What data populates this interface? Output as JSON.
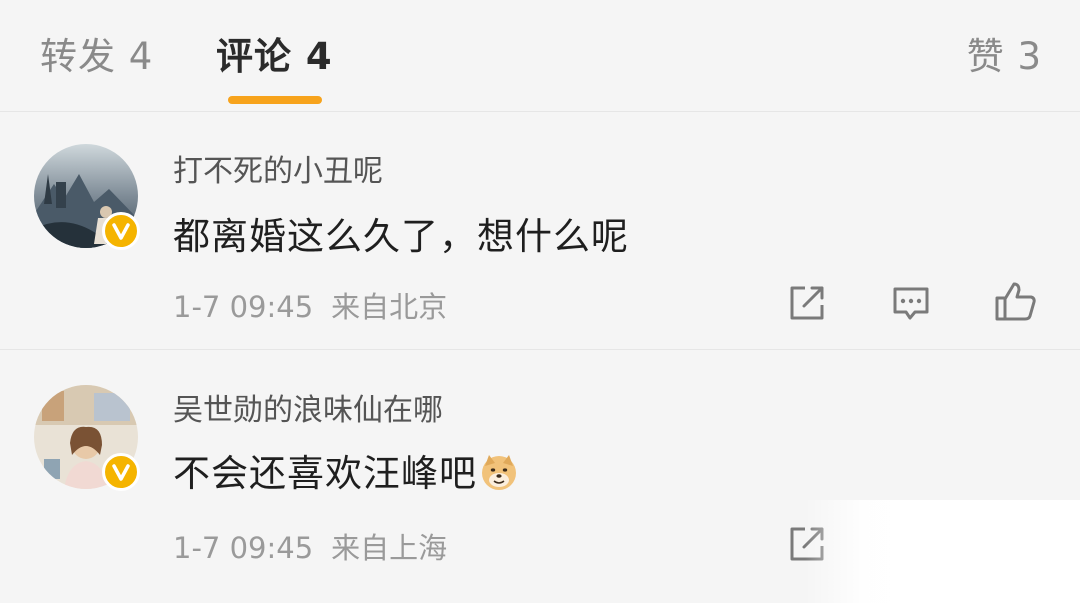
{
  "tabs": {
    "repost": "转发 4",
    "comment": "评论 4",
    "like": "赞 3"
  },
  "colors": {
    "background": "#f5f5f5",
    "accent": "#f7a31c",
    "badge": "#f5b400",
    "text_primary": "#1f1f1f",
    "text_secondary": "#9a9a9a"
  },
  "comments": [
    {
      "username": "打不死的小丑呢",
      "text": "都离婚这么久了，想什么呢",
      "time": "1-7 09:45",
      "location": "来自北京",
      "verified_badge": "v-badge-icon",
      "actions": [
        "repost-icon",
        "reply-icon",
        "like-icon"
      ]
    },
    {
      "username": "吴世勋的浪味仙在哪",
      "text": "不会还喜欢汪峰吧",
      "emoji": "doge-emoji",
      "time": "1-7 09:45",
      "location": "来自上海",
      "verified_badge": "v-badge-icon",
      "actions": [
        "repost-icon"
      ]
    }
  ]
}
